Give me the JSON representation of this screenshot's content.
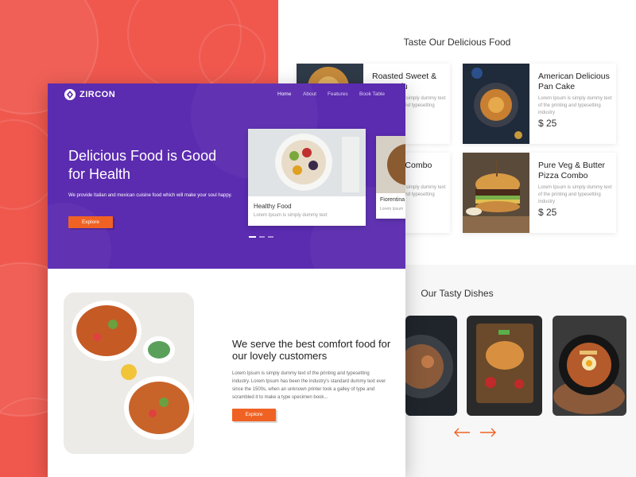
{
  "brand": {
    "name": "ZIRCON"
  },
  "nav": {
    "items": [
      "Home",
      "About",
      "Features",
      "Book Table"
    ]
  },
  "hero": {
    "title": "Delicious Food is Good for Health",
    "subtitle": "We provide Italian and mexican cuisine food which will make your soul happy.",
    "button": "Explore",
    "slides": [
      {
        "title": "Healthy Food",
        "desc": "Lorem Ipsum is simply dummy text"
      },
      {
        "title": "Fiorentina",
        "desc": "Lorem Ipsum"
      }
    ]
  },
  "comfort": {
    "title": "We serve the best comfort food for our lovely customers",
    "desc": "Lorem Ipsum is simply dummy text of the printing and typesetting industry. Lorem Ipsum has been the industry's standard dummy text ever since the 1500s, when an unknown printer took a galley of type and scrambled it to make a type specimen book...",
    "button": "Explore"
  },
  "menu": {
    "title": "Taste Our Delicious Food",
    "cards": [
      {
        "name": "Roasted Sweet & Sour Tofu",
        "desc": "Lorem Ipsum is simply dummy text of the printing and typesetting industry",
        "price": ""
      },
      {
        "name": "American Delicious Pan Cake",
        "desc": "Lorem Ipsum is simply dummy text of the printing and typesetting industry",
        "price": "$ 25"
      },
      {
        "name": "Gnocchi Combo",
        "desc": "Lorem Ipsum is simply dummy text of the printing and typesetting industry",
        "price": ""
      },
      {
        "name": "Pure Veg & Butter Pizza Combo",
        "desc": "Lorem Ipsum is simply dummy text of the printing and typesetting industry",
        "price": "$ 25"
      }
    ]
  },
  "dishes": {
    "title": "Our Tasty Dishes"
  },
  "colors": {
    "accent": "#f06223",
    "hero": "#5b2bb0",
    "coral": "#f0584e"
  }
}
